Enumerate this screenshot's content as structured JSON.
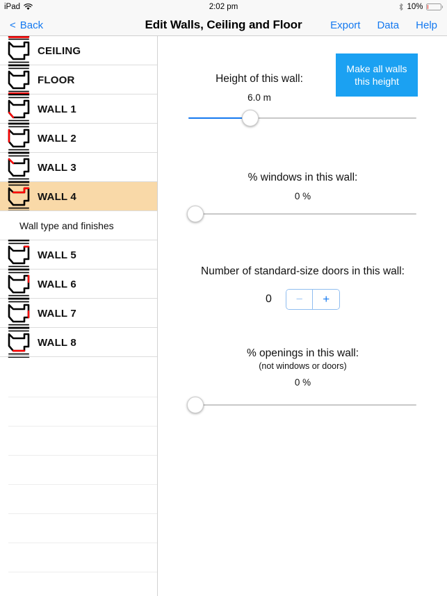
{
  "status_bar": {
    "device": "iPad",
    "wifi_icon": "wifi-icon",
    "time": "2:02 pm",
    "bluetooth_icon": "bluetooth-icon",
    "battery_percent": "10%",
    "battery_level": 10,
    "battery_color": "#e8332a"
  },
  "nav_bar": {
    "back_chevron": "<",
    "back_label": "Back",
    "title": "Edit Walls, Ceiling and Floor",
    "actions": [
      {
        "label": "Export",
        "name": "export-button"
      },
      {
        "label": "Data",
        "name": "data-button"
      },
      {
        "label": "Help",
        "name": "help-button"
      }
    ],
    "tint_color": "#1479f0"
  },
  "sidebar": {
    "selected_index": 5,
    "selected_row_color": "#f9d9a8",
    "highlight_color": "#ff0000",
    "rows": [
      {
        "label": "CEILING",
        "icon": "room-section-icon",
        "edge": "top",
        "selected": false
      },
      {
        "label": "FLOOR",
        "icon": "room-section-icon",
        "edge": "bottom",
        "selected": false
      },
      {
        "label": "WALL 1",
        "icon": "room-section-icon",
        "edge": "bottom-left",
        "selected": false
      },
      {
        "label": "WALL 2",
        "icon": "room-section-icon",
        "edge": "left",
        "selected": false
      },
      {
        "label": "WALL 3",
        "icon": "room-section-icon",
        "edge": "top-left",
        "selected": false
      },
      {
        "label": "WALL 4",
        "icon": "room-section-icon",
        "edge": "top-inner",
        "selected": true
      },
      {
        "label": "WALL 5",
        "icon": "room-section-icon",
        "edge": "top-right",
        "selected": false
      },
      {
        "label": "WALL 6",
        "icon": "room-section-icon",
        "edge": "right-upper",
        "selected": false
      },
      {
        "label": "WALL 7",
        "icon": "room-section-icon",
        "edge": "right",
        "selected": false
      },
      {
        "label": "WALL 8",
        "icon": "room-section-icon",
        "edge": "bottom-inner",
        "selected": false
      }
    ],
    "sub_row": {
      "label": "Wall type and finishes",
      "after_index": 5
    },
    "empty_rows": 8
  },
  "detail": {
    "height_section": {
      "title": "Height of this wall:",
      "value": "6.0 m",
      "slider_percent": 27,
      "fill_color": "#1479f0"
    },
    "make_all_walls_button": {
      "line1": "Make all walls",
      "line2": "this height",
      "color": "#1ba1f2"
    },
    "windows_section": {
      "title": "% windows in this wall:",
      "value": "0 %",
      "slider_percent": 0
    },
    "doors_section": {
      "title": "Number of standard-size doors in this wall:",
      "value": "0",
      "minus_label": "−",
      "plus_label": "+",
      "minus_enabled": false,
      "plus_enabled": true
    },
    "openings_section": {
      "title": "% openings in this wall:",
      "subtitle": "(not windows or doors)",
      "value": "0 %",
      "slider_percent": 0
    }
  }
}
